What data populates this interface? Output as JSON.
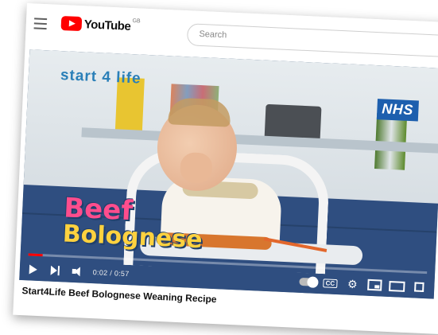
{
  "masthead": {
    "logo_text": "YouTube",
    "country_code": "GB",
    "search_placeholder": "Search"
  },
  "video": {
    "overlay_brand": "start 4 life",
    "overlay_badge": "NHS",
    "overlay_title_line1": "Beef",
    "overlay_title_line2": "Bolognese",
    "time_display": "0:02 / 0:57",
    "progress_fraction": 0.035,
    "title": "Start4Life Beef Bolognese Weaning Recipe"
  },
  "colors": {
    "brand_red": "#ff0000",
    "nhs_blue": "#1d5fae"
  },
  "icons": [
    "menu-icon",
    "youtube-logo-icon",
    "play-icon",
    "next-icon",
    "volume-icon",
    "autoplay-toggle-icon",
    "captions-icon",
    "gear-icon",
    "miniplayer-icon",
    "theater-icon",
    "fullscreen-icon"
  ]
}
